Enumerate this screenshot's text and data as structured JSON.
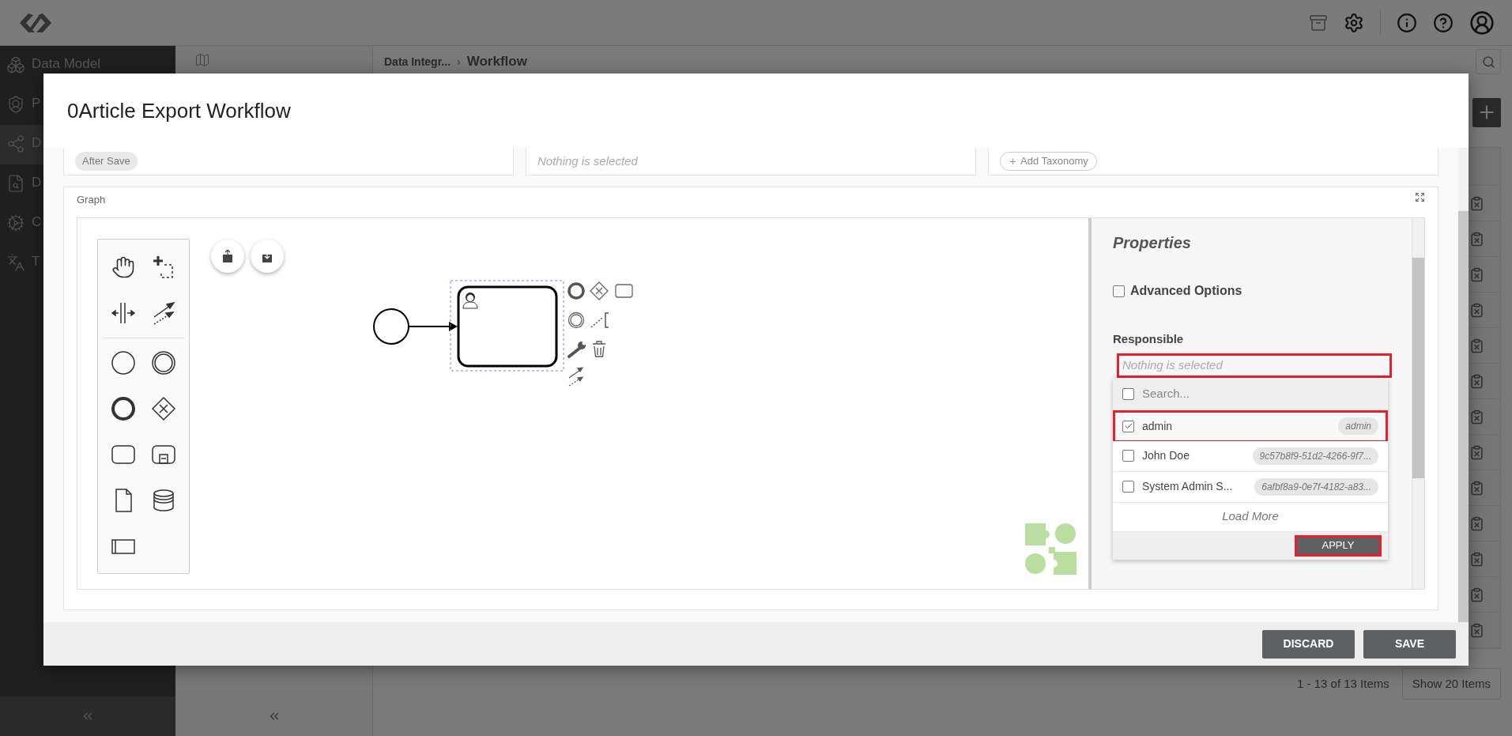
{
  "sidebar": {
    "items": [
      {
        "label": "Data Model",
        "selected": false
      },
      {
        "label": "P",
        "selected": false
      },
      {
        "label": "D",
        "selected": true
      },
      {
        "label": "D",
        "selected": false
      },
      {
        "label": "C",
        "selected": false
      },
      {
        "label": "T",
        "selected": false
      }
    ]
  },
  "breadcrumb": [
    {
      "label": "Data Integr..."
    },
    {
      "separator": "›",
      "label": "Workflow"
    }
  ],
  "pagination": {
    "summary": "1 - 13 of 13 Items",
    "page_size": "Show 20 Items"
  },
  "dialog": {
    "title": "0Article Export Workflow",
    "top_fields": [
      {
        "kind": "chip",
        "text": "After Save"
      },
      {
        "kind": "placeholder",
        "text": "Nothing is selected"
      },
      {
        "kind": "add_button",
        "text": "Add Taxonomy"
      }
    ],
    "graph": {
      "label": "Graph",
      "properties": {
        "title": "Properties",
        "advanced_options": {
          "label": "Advanced Options",
          "checked": false
        },
        "responsible": {
          "label": "Responsible",
          "placeholder": "Nothing is selected",
          "highlighted": true,
          "search_placeholder": "Search...",
          "select_all_checked": false,
          "options": [
            {
              "name": "admin",
              "id": "admin",
              "checked": true,
              "highlighted": true
            },
            {
              "name": "John Doe",
              "id": "9c57b8f9-51d2-4266-9f7...",
              "checked": false,
              "highlighted": false
            },
            {
              "name": "System Admin S...",
              "id": "6afbf8a9-0e7f-4182-a83...",
              "checked": false,
              "highlighted": false
            }
          ],
          "load_more": "Load More",
          "apply": {
            "label": "APPLY",
            "highlighted": true
          }
        }
      }
    },
    "buttons": [
      {
        "label": "DISCARD"
      },
      {
        "label": "SAVE"
      }
    ]
  }
}
